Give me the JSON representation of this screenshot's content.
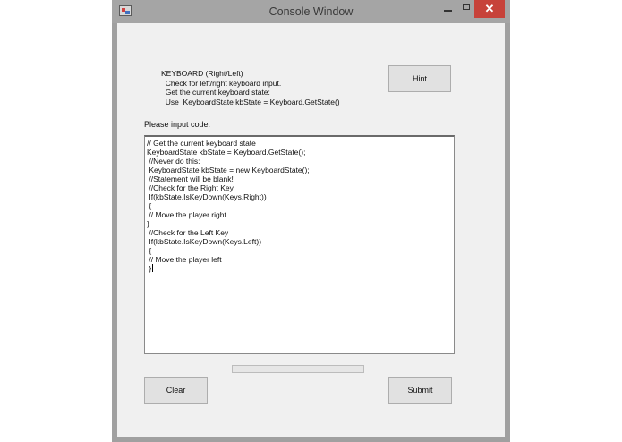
{
  "window": {
    "title": "Console Window",
    "close_glyph": "✕"
  },
  "info": {
    "lines": [
      "KEYBOARD (Right/Left)",
      "  Check for left/right keyboard input.",
      "  Get the current keyboard state:",
      "  Use  KeyboardState kbState = Keyboard.GetState()"
    ]
  },
  "buttons": {
    "hint": "Hint",
    "clear": "Clear",
    "submit": "Submit"
  },
  "prompt_label": "Please input code:",
  "code": {
    "lines": [
      "// Get the current keyboard state",
      "KeyboardState kbState = Keyboard.GetState();",
      " //Never do this:",
      " KeyboardState kbState = new KeyboardState();",
      " //Statement will be blank!",
      " //Check for the Right Key",
      " If(kbState.IsKeyDown(Keys.Right))",
      " {",
      " // Move the player right",
      "}",
      " //Check for the Left Key",
      " If(kbState.IsKeyDown(Keys.Left))",
      " {",
      " // Move the player left",
      " }"
    ]
  },
  "progress": {
    "value_fraction": 0
  },
  "colors": {
    "close_button": "#c7423a",
    "progress_fill": "#06b025"
  }
}
